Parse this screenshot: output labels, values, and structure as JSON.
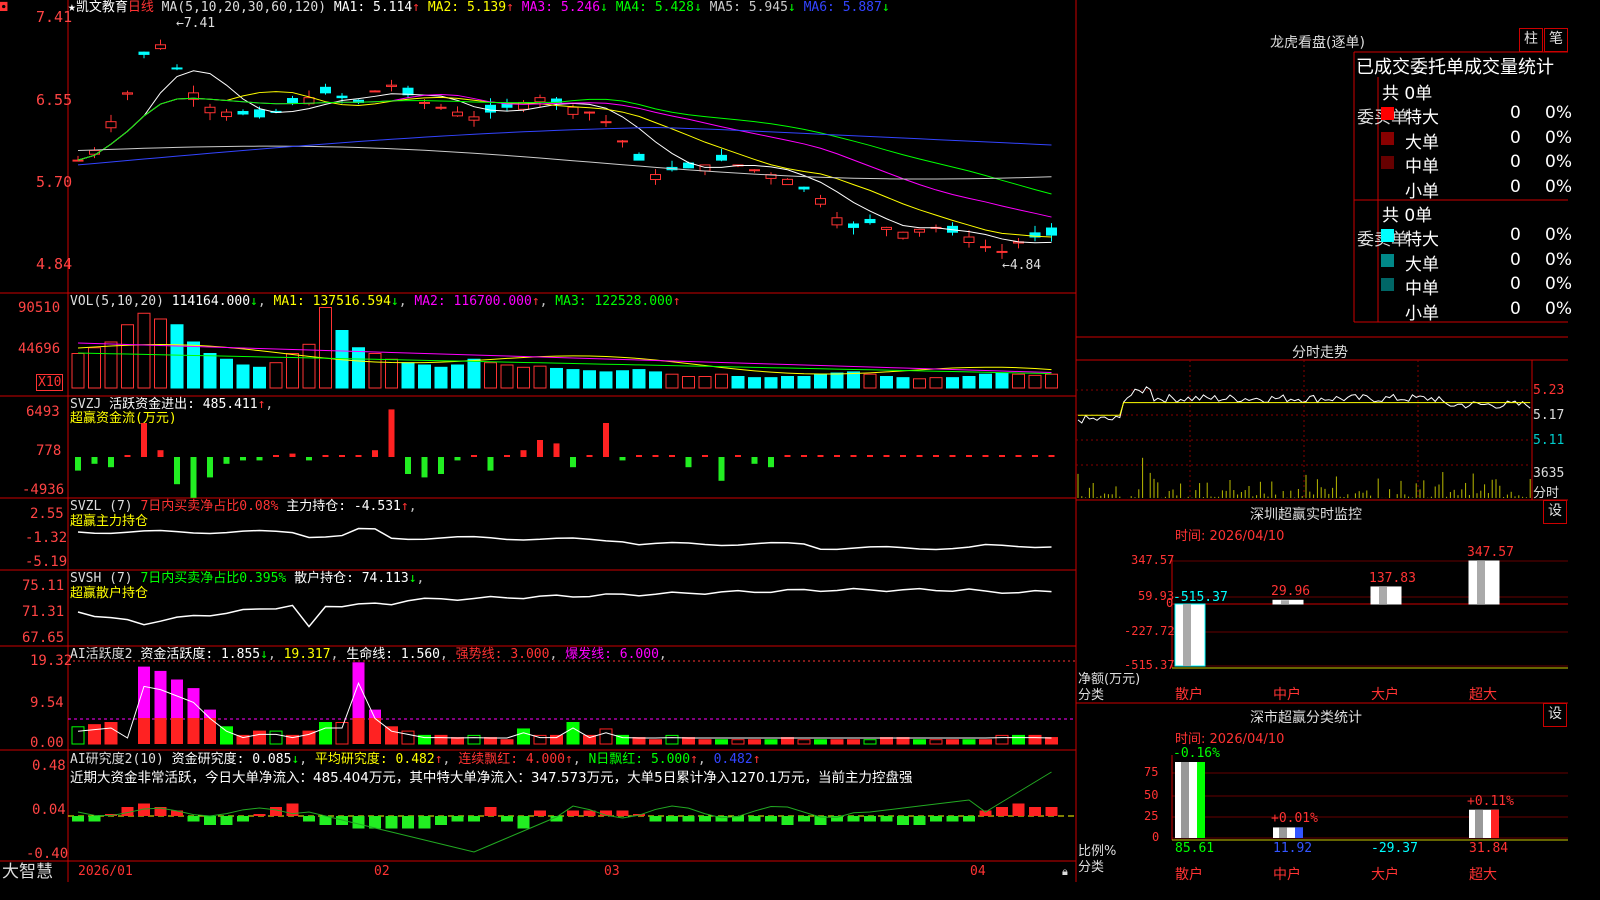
{
  "app": {
    "brand": "大智慧"
  },
  "main_chart": {
    "title": "★凯文教育",
    "period": "日线",
    "ma_spec": "MA(5,10,20,30,60,120)",
    "ma_items": [
      {
        "label": "MA1:",
        "value": "5.114",
        "arrow": "↑",
        "color": "#ffffff"
      },
      {
        "label": "MA2:",
        "value": "5.139",
        "arrow": "↑",
        "color": "#ffff00"
      },
      {
        "label": "MA3:",
        "value": "5.246",
        "arrow": "↓",
        "color": "#ff00ff"
      },
      {
        "label": "MA4:",
        "value": "5.428",
        "arrow": "↓",
        "color": "#00ff00"
      },
      {
        "label": "MA5:",
        "value": "5.945",
        "arrow": "↓",
        "color": "#cccccc"
      },
      {
        "label": "MA6:",
        "value": "5.887",
        "arrow": "↓",
        "color": "#3344ff"
      }
    ],
    "high_label": "7.41",
    "low_label": "4.84",
    "y_ticks": [
      "7.41",
      "6.55",
      "5.70",
      "4.84"
    ]
  },
  "volume": {
    "spec": "VOL(5,10,20)",
    "value": "114164.000",
    "value_arrow": "↓",
    "ma1": "MA1: 137516.594",
    "ma1_arrow": "↓",
    "ma2": "MA2: 116700.000",
    "ma2_arrow": "↑",
    "ma3": "MA3: 122528.000",
    "ma3_arrow": "↑",
    "y_ticks": [
      "90510",
      "44696"
    ],
    "unit": "X10"
  },
  "svzj": {
    "spec": "SVZJ",
    "label": "活跃资金进出: 485.411",
    "arrow": "↑",
    "sub": "超赢资金流(万元)",
    "y_ticks": [
      "6493",
      "778",
      "-4936"
    ]
  },
  "svzl": {
    "spec": "SVZL (7)",
    "text1": "7日内买卖净占比0.08%",
    "text2": "主力持仓: -4.531",
    "arrow": "↑",
    "sub": "超赢主力持仓",
    "y_ticks": [
      "2.55",
      "-1.32",
      "-5.19"
    ]
  },
  "svsh": {
    "spec": "SVSH (7)",
    "text1": "7日内买卖净占比0.395%",
    "text2": "散户持仓: 74.113",
    "arrow": "↓",
    "sub": "超赢散户持仓",
    "y_ticks": [
      "75.11",
      "71.31",
      "67.65"
    ]
  },
  "ai_active": {
    "spec": "AI活跃度2",
    "t1": "资金活跃度: 1.855",
    "t2": "19.317",
    "t3": "生命线: 1.560",
    "t4": "强势线: 3.000",
    "t5": "爆发线: 6.000",
    "y_ticks": [
      "19.32",
      "9.54",
      "0.00"
    ]
  },
  "ai_research": {
    "spec": "AI研究度2(10)",
    "t1": "资金研究度: 0.085",
    "t2": "平均研究度: 0.482",
    "t3": "连续飘红: 4.000",
    "t4": "N日飘红: 5.000",
    "t5": "0.482",
    "summary": "近期大资金非常活跃，今日大单净流入：485.404万元，其中特大单净流入：347.573万元，大单5日累计净入1270.1万元，当前主力控盘强",
    "y_ticks": [
      "0.48",
      "0.04",
      "-0.40"
    ]
  },
  "x_axis": [
    "2026/01",
    "02",
    "03",
    "04"
  ],
  "dragon": {
    "title": "龙虎看盘(逐单)",
    "btn1": "柱",
    "btn2": "笔",
    "tabs": "已成交委托单成交量统计",
    "buy_label": "委买单",
    "sell_label": "委卖单",
    "buy_total": "共 0单",
    "sell_total": "共 0单",
    "rows": [
      {
        "name": "特大",
        "count": "0",
        "pct": "0%"
      },
      {
        "name": "大单",
        "count": "0",
        "pct": "0%"
      },
      {
        "name": "中单",
        "count": "0",
        "pct": "0%"
      },
      {
        "name": "小单",
        "count": "0",
        "pct": "0%"
      }
    ],
    "buy_colors": [
      "#ff0000",
      "#880000",
      "#660000",
      "#000000"
    ],
    "sell_colors": [
      "#00ffff",
      "#008888",
      "#006666",
      "#000000"
    ]
  },
  "intraday": {
    "title": "分时走势",
    "price_ticks": [
      "5.23",
      "5.17",
      "5.11"
    ],
    "vol_tick": "3635",
    "vol_unit": "分时"
  },
  "sz_monitor": {
    "title": "深圳超赢实时监控",
    "settings": "设",
    "time": "时间: 2026/04/10",
    "y_ticks": [
      "347.57",
      "59.93",
      "0",
      "-227.72",
      "-515.37"
    ],
    "y_caption": "净额(万元)",
    "x_caption": "分类",
    "chart_data": {
      "type": "bar",
      "categories": [
        "散户",
        "中户",
        "大户",
        "超大"
      ],
      "values": [
        -515.37,
        29.96,
        137.83,
        347.57
      ],
      "ylim": [
        -515.37,
        347.57
      ]
    }
  },
  "sz_class": {
    "title": "深市超赢分类统计",
    "settings": "设",
    "time": "时间: 2026/04/10",
    "y_ticks": [
      "75",
      "50",
      "25",
      "0"
    ],
    "y_caption": "比例%",
    "x_caption": "分类",
    "chart_data": {
      "type": "bar",
      "categories": [
        "散户",
        "中户",
        "大户",
        "超大"
      ],
      "values": [
        85.61,
        11.92,
        -29.37,
        31.84
      ],
      "changes": [
        "-0.16%",
        "+0.01%",
        "",
        "+0.11%"
      ],
      "ylim": [
        0,
        85.61
      ]
    }
  }
}
